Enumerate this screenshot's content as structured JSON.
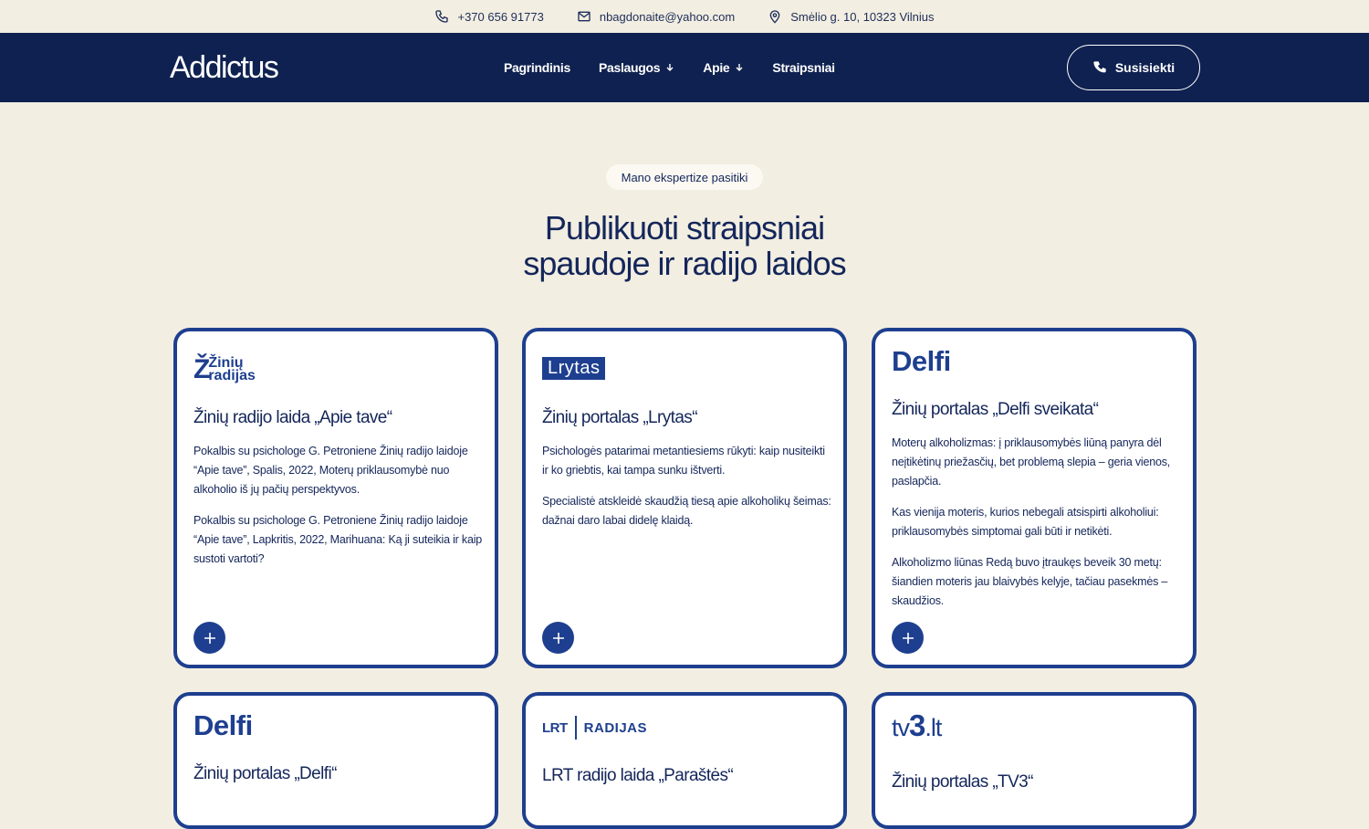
{
  "topbar": {
    "phone": "+370 656 91773",
    "email": "nbagdonaite@yahoo.com",
    "address": "Smėlio g. 10, 10323 Vilnius"
  },
  "nav": {
    "logo": "Addictus",
    "items": [
      {
        "label": "Pagrindinis",
        "dropdown": false
      },
      {
        "label": "Paslaugos",
        "dropdown": true
      },
      {
        "label": "Apie",
        "dropdown": true
      },
      {
        "label": "Straipsniai",
        "dropdown": false
      }
    ],
    "cta": "Susisiekti"
  },
  "hero": {
    "badge": "Mano ekspertize pasitiki",
    "title_line1": "Publikuoti straipsniai",
    "title_line2": "spaudoje ir radijo laidos"
  },
  "cards": [
    {
      "logo_icon": "ziniu-radijas-logo",
      "logo_text": [
        "Ž",
        "Žinių",
        "radijas"
      ],
      "title": "Žinių radijo laida „Apie tave“",
      "paragraphs": [
        "Pokalbis su psichologe G. Petroniene Žinių radijo laidoje “Apie tave”, Spalis, 2022, Moterų priklausomybė nuo alkoholio iš jų pačių perspektyvos.",
        "Pokalbis su psichologe G. Petroniene Žinių radijo laidoje “Apie tave”, Lapkritis, 2022, Marihuana: Ką ji suteikia ir kaip sustoti vartoti?"
      ]
    },
    {
      "logo_icon": "lrytas-logo",
      "logo_text": [
        "Lrytas"
      ],
      "title": "Žinių portalas „Lrytas“",
      "paragraphs": [
        "Psichologės patarimai metantiesiems rūkyti: kaip nusiteikti ir ko griebtis, kai tampa sunku ištverti.",
        "Specialistė atskleidė skaudžią tiesą apie alkoholikų šeimas: dažnai daro labai didelę klaidą."
      ]
    },
    {
      "logo_icon": "delfi-logo",
      "logo_text": [
        "Delfi"
      ],
      "title": "Žinių portalas „Delfi sveikata“",
      "paragraphs": [
        "Moterų alkoholizmas: į priklausomybės liūną panyra dėl neįtikėtinų priežasčių, bet problemą slepia – geria vienos, paslapčia.",
        "Kas vienija moteris, kurios nebegali atsispirti alkoholiui: priklausomybės simptomai gali būti ir netikėti.",
        "Alkoholizmo liūnas Redą buvo įtraukęs beveik 30 metų: šiandien moteris jau blaivybės kelyje, tačiau pasekmės – skaudžios."
      ]
    },
    {
      "logo_icon": "delfi-logo",
      "logo_text": [
        "Delfi"
      ],
      "title": "Žinių portalas „Delfi“",
      "paragraphs": []
    },
    {
      "logo_icon": "lrt-radijas-logo",
      "logo_text": [
        "LRT",
        "RADIJAS"
      ],
      "title": "LRT radijo laida „Paraštės“",
      "paragraphs": []
    },
    {
      "logo_icon": "tv3-logo",
      "logo_text": [
        "tv",
        "3",
        ".lt"
      ],
      "title": "Žinių portalas „TV3“",
      "paragraphs": []
    }
  ],
  "colors": {
    "background": "#f2eee1",
    "navy": "#0f2150",
    "accent": "#1e3f8f"
  }
}
